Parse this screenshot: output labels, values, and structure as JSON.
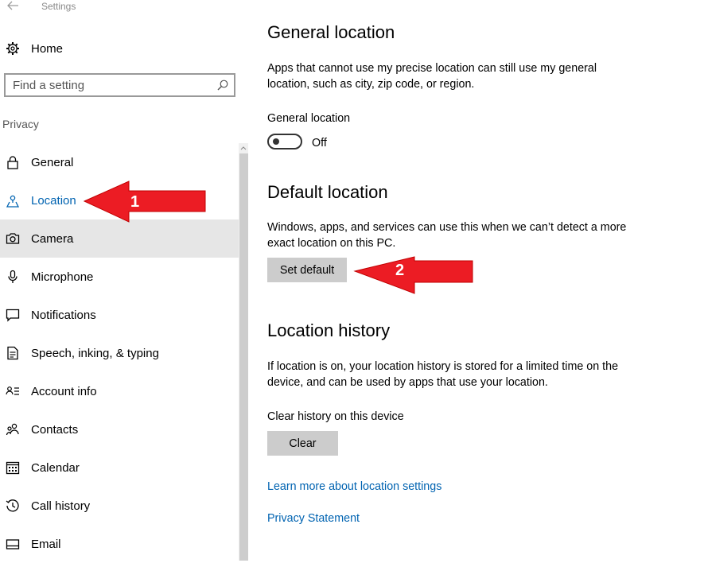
{
  "window": {
    "title": "Settings"
  },
  "sidebar": {
    "home_label": "Home",
    "search_placeholder": "Find a setting",
    "section_heading": "Privacy",
    "items": [
      {
        "label": "General",
        "icon": "lock-icon"
      },
      {
        "label": "Location",
        "icon": "location-icon",
        "selected": true
      },
      {
        "label": "Camera",
        "icon": "camera-icon",
        "hover": true
      },
      {
        "label": "Microphone",
        "icon": "microphone-icon"
      },
      {
        "label": "Notifications",
        "icon": "notifications-icon"
      },
      {
        "label": "Speech, inking, & typing",
        "icon": "speech-icon"
      },
      {
        "label": "Account info",
        "icon": "account-info-icon"
      },
      {
        "label": "Contacts",
        "icon": "contacts-icon"
      },
      {
        "label": "Calendar",
        "icon": "calendar-icon"
      },
      {
        "label": "Call history",
        "icon": "call-history-icon"
      },
      {
        "label": "Email",
        "icon": "email-icon"
      }
    ]
  },
  "main": {
    "general_location": {
      "heading": "General location",
      "description": "Apps that cannot use my precise location can still use my general location, such as city, zip code, or region.",
      "toggle_label": "General location",
      "toggle_state": "Off"
    },
    "default_location": {
      "heading": "Default location",
      "description": "Windows, apps, and services can use this when we can’t detect a more exact location on this PC.",
      "button_label": "Set default"
    },
    "location_history": {
      "heading": "Location history",
      "description": "If location is on, your location history is stored for a limited time on the device, and can be used by apps that use your location.",
      "clear_label": "Clear history on this device",
      "clear_button": "Clear"
    },
    "links": {
      "learn_more": "Learn more about location settings",
      "privacy_statement": "Privacy Statement"
    }
  },
  "annotations": {
    "arrow_1": "1",
    "arrow_2": "2",
    "arrow_color": "#ec1c24"
  },
  "colors": {
    "accent": "#0063b1",
    "hover_bg": "#e6e6e6",
    "button_bg": "#cccccc"
  }
}
